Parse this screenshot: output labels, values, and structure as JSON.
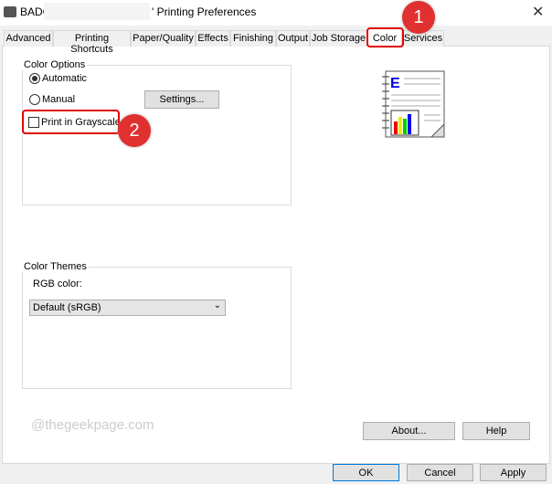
{
  "window": {
    "title_prefix": "BADGE",
    "title_suffix": "' Printing Preferences",
    "close": "✕"
  },
  "tabs": [
    "Advanced",
    "Printing Shortcuts",
    "Paper/Quality",
    "Effects",
    "Finishing",
    "Output",
    "Job Storage",
    "Color",
    "Services"
  ],
  "selected_tab": "Color",
  "color_options": {
    "label": "Color Options",
    "automatic": "Automatic",
    "manual": "Manual",
    "settings": "Settings...",
    "grayscale": "Print in Grayscale",
    "selected": "Automatic",
    "grayscale_checked": false
  },
  "color_themes": {
    "label": "Color Themes",
    "rgb_label": "RGB color:",
    "rgb_value": "Default (sRGB)"
  },
  "watermark": "@thegeekpage.com",
  "buttons": {
    "about": "About...",
    "help": "Help",
    "ok": "OK",
    "cancel": "Cancel",
    "apply": "Apply"
  },
  "annotations": {
    "one": "1",
    "two": "2",
    "color": "#e03030"
  }
}
